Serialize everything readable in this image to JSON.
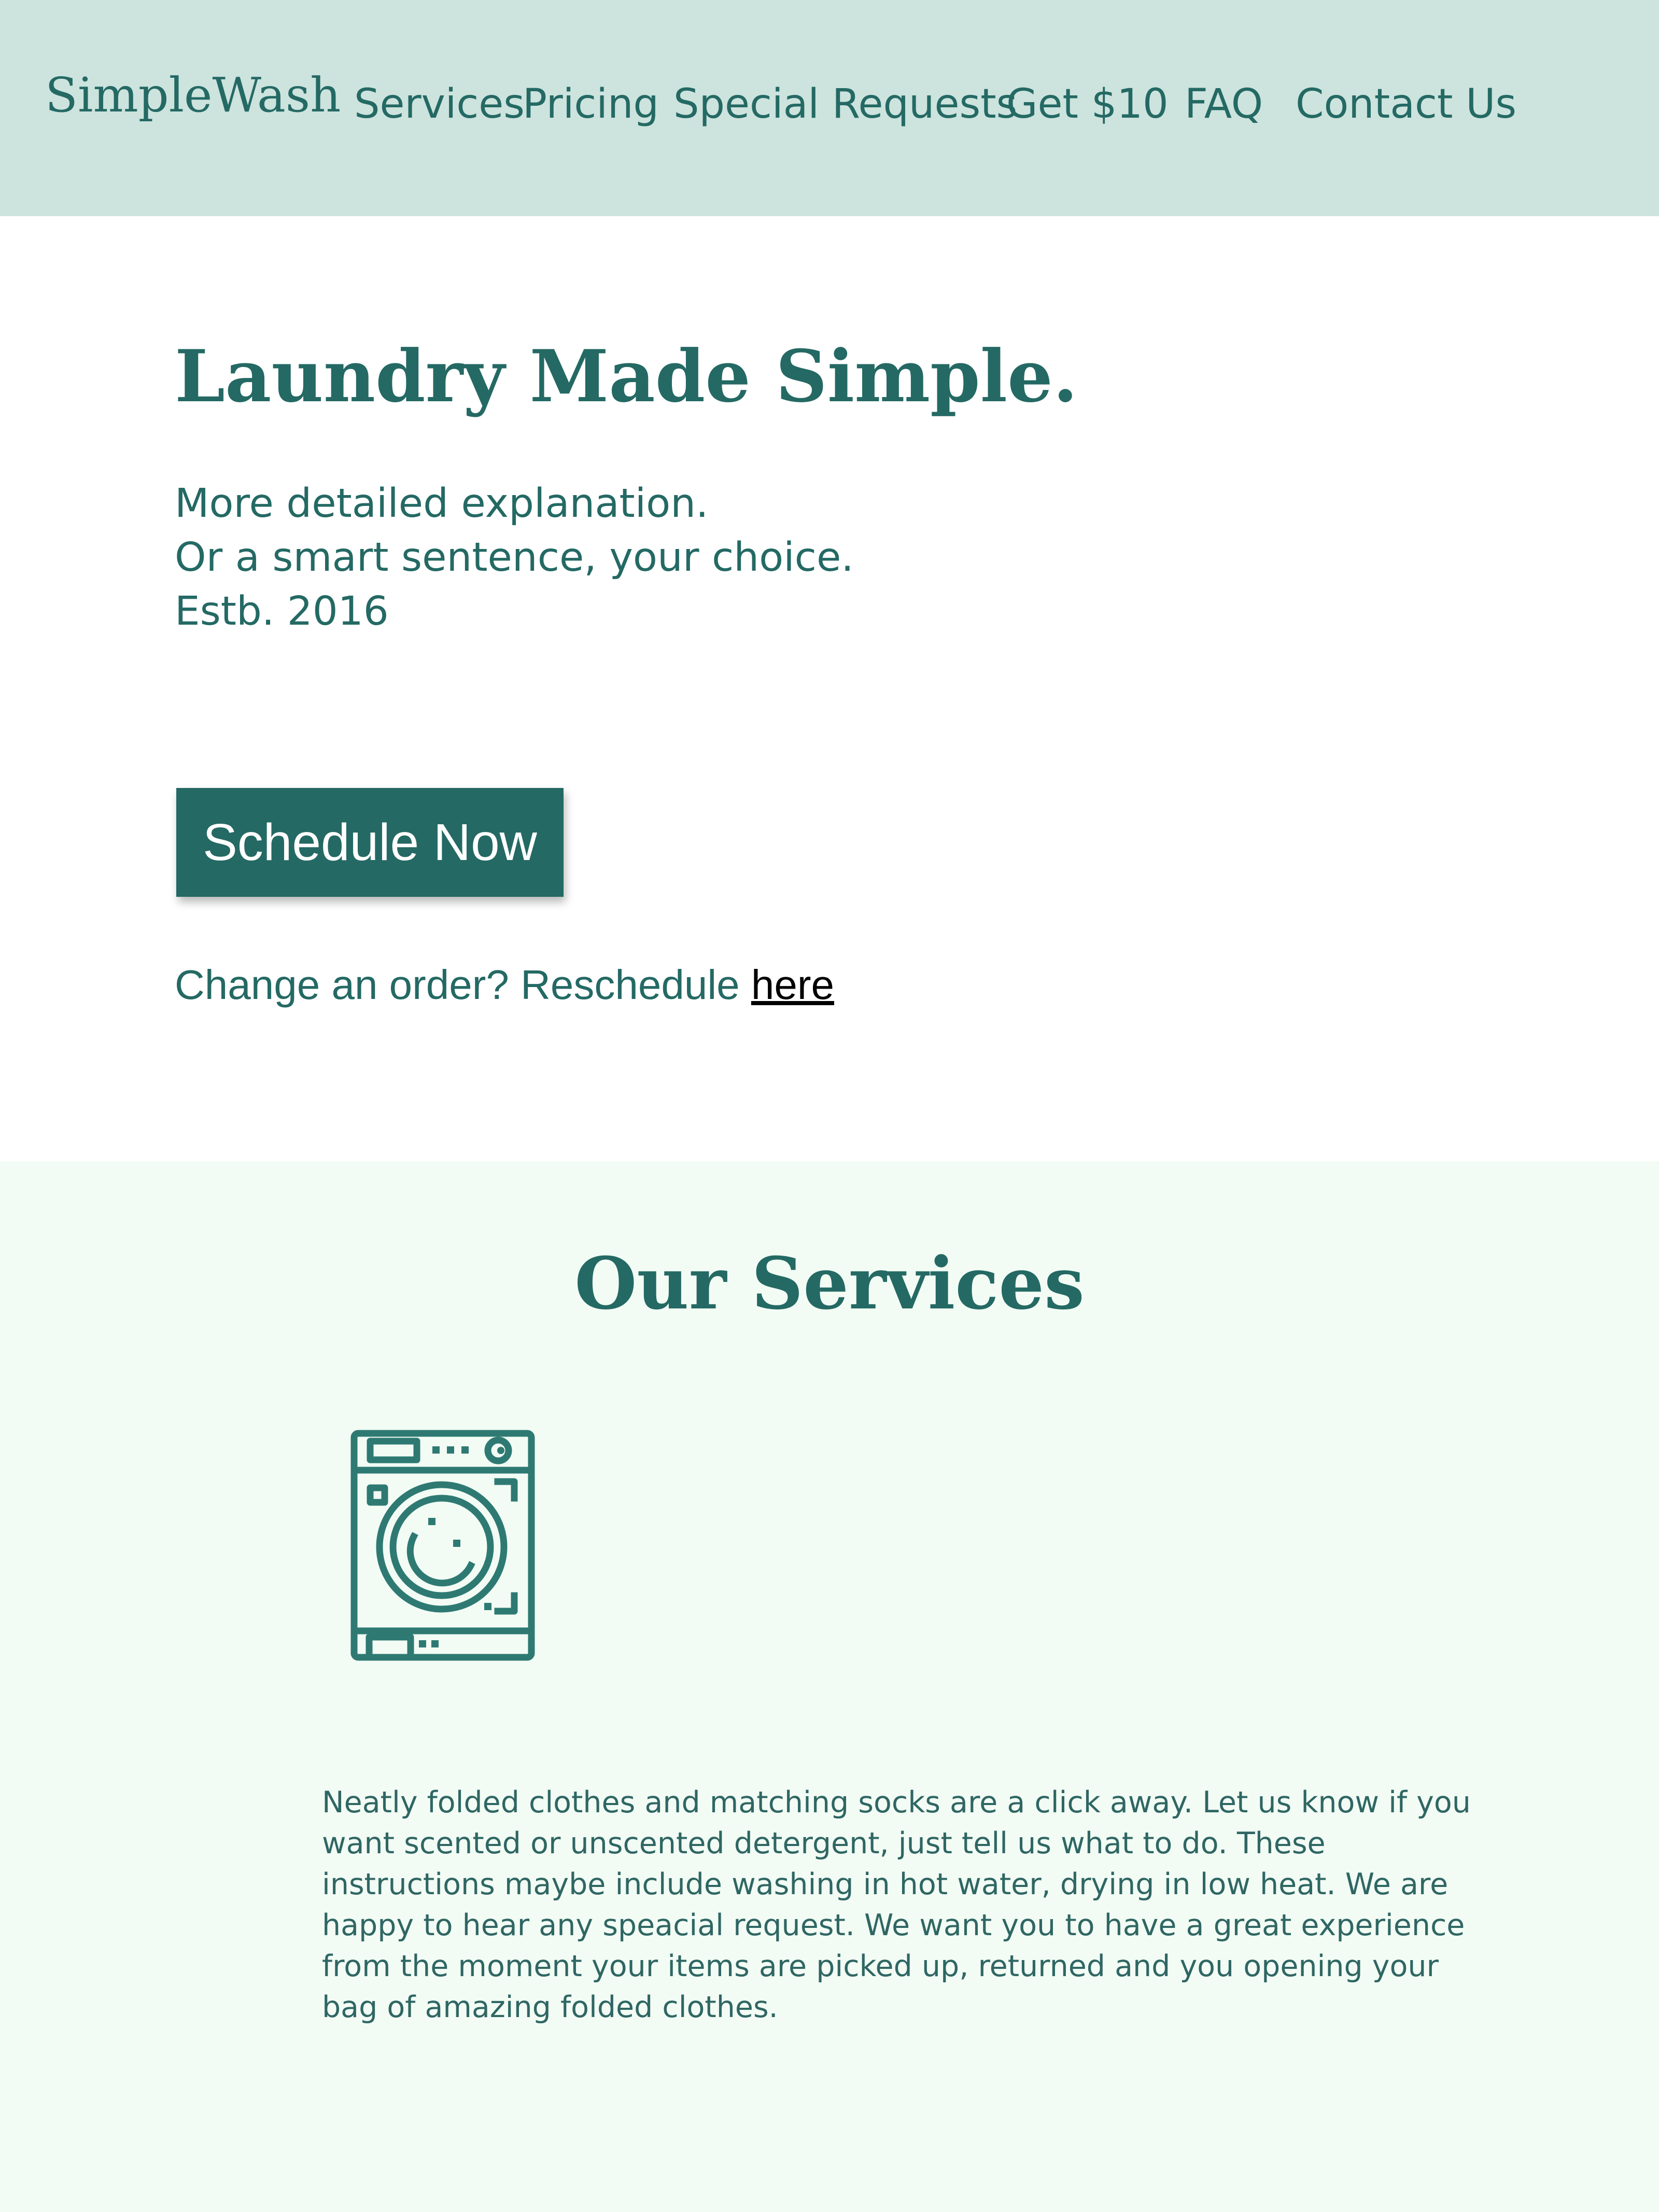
{
  "header": {
    "brand": "SimpleWash",
    "nav": [
      {
        "label": "Services"
      },
      {
        "label": "Pricing"
      },
      {
        "label": "Special Requests"
      },
      {
        "label": "Get $10"
      },
      {
        "label": "FAQ"
      },
      {
        "label": "Contact Us"
      }
    ]
  },
  "hero": {
    "title": "Laundry Made Simple.",
    "lines": [
      "More detailed explanation.",
      "Or a smart sentence, your choice.",
      "Estb. 2016"
    ],
    "cta_label": "Schedule Now",
    "reschedule_text": "Change an order? Reschedule ",
    "reschedule_link": "here"
  },
  "services": {
    "title": "Our Services",
    "icon": "washing-machine-icon",
    "description": "Neatly folded clothes and matching socks are a click away. Let us know if you want scented or unscented detergent, just tell us what to do. These instructions maybe include washing in hot water, drying in low heat. We are happy to hear any speacial request. We want you to have a great experience from the moment your items are picked up, returned and you opening your bag of amazing folded clothes."
  },
  "colors": {
    "header_bg": "#CDE3DD",
    "accent": "#246964",
    "services_bg": "#F2FCF4",
    "button_text": "#FFFFFF",
    "link": "#000000"
  }
}
